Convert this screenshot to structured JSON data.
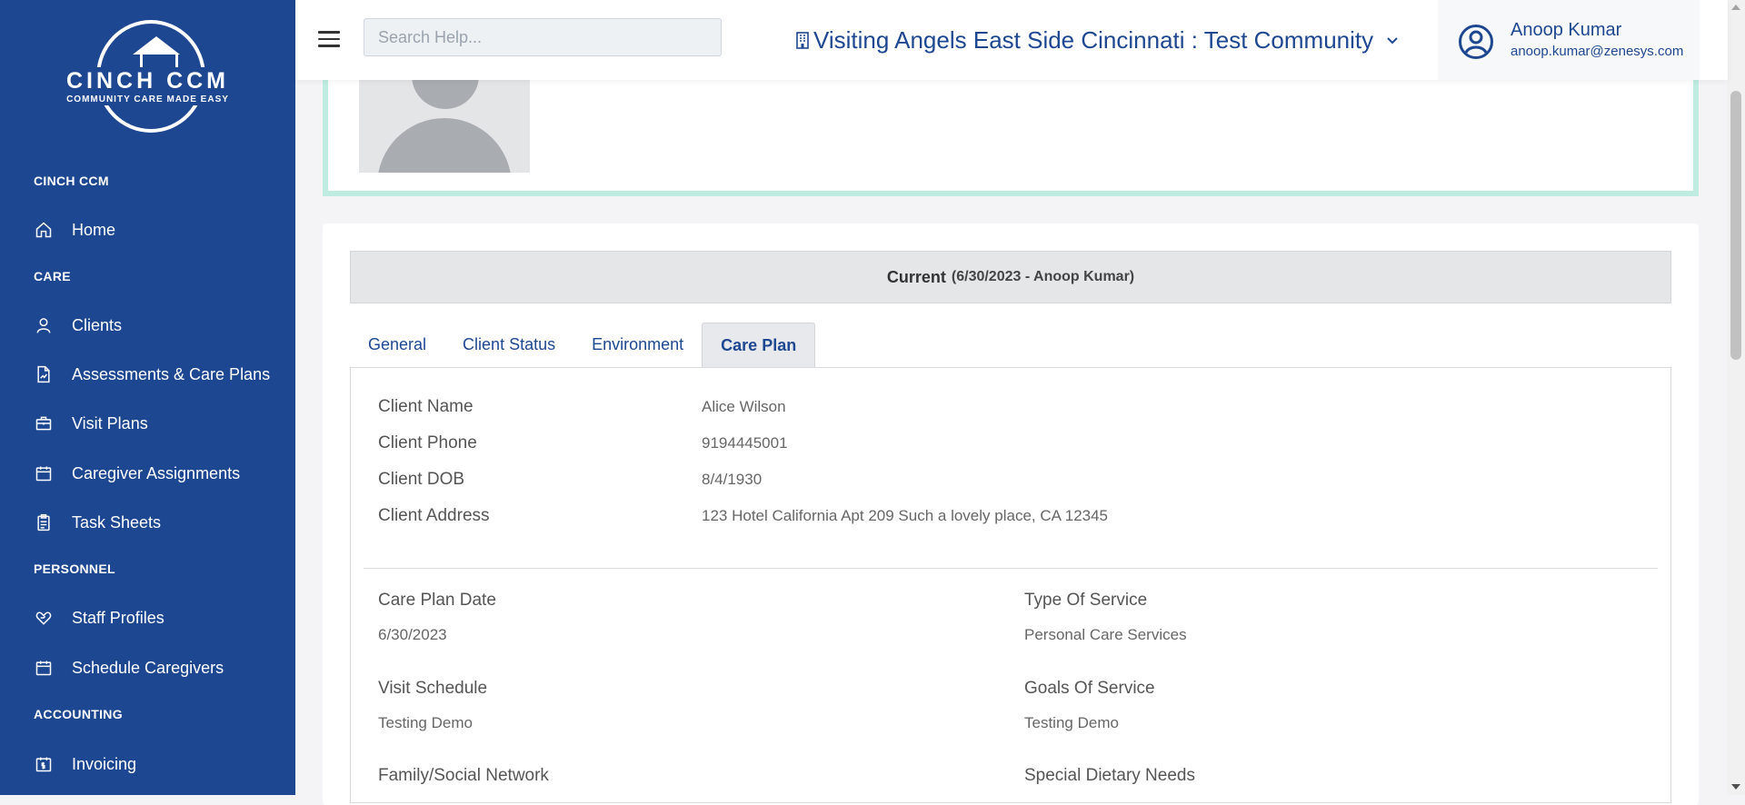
{
  "sidebar": {
    "logo": {
      "title": "CINCH CCM",
      "tagline": "COMMUNITY CARE MADE EASY"
    },
    "sections": [
      {
        "title": "CINCH CCM",
        "items": [
          {
            "label": "Home",
            "icon": "home-icon"
          }
        ]
      },
      {
        "title": "CARE",
        "items": [
          {
            "label": "Clients",
            "icon": "user-icon"
          },
          {
            "label": "Assessments & Care Plans",
            "icon": "document-chart-icon"
          },
          {
            "label": "Visit Plans",
            "icon": "briefcase-icon"
          },
          {
            "label": "Caregiver Assignments",
            "icon": "calendar-icon"
          },
          {
            "label": "Task Sheets",
            "icon": "clipboard-icon"
          }
        ]
      },
      {
        "title": "PERSONNEL",
        "items": [
          {
            "label": "Staff Profiles",
            "icon": "heart-hand-icon"
          },
          {
            "label": "Schedule Caregivers",
            "icon": "calendar-icon"
          }
        ]
      },
      {
        "title": "ACCOUNTING",
        "items": [
          {
            "label": "Invoicing",
            "icon": "invoice-icon"
          }
        ]
      }
    ]
  },
  "header": {
    "search_placeholder": "Search Help...",
    "community": "Visiting Angels East Side Cincinnati : Test Community",
    "user": {
      "name": "Anoop Kumar",
      "email": "anoop.kumar@zenesys.com"
    }
  },
  "current": {
    "label": "Current",
    "detail": "(6/30/2023 - Anoop Kumar)"
  },
  "tabs": [
    {
      "label": "General",
      "active": false
    },
    {
      "label": "Client Status",
      "active": false
    },
    {
      "label": "Environment",
      "active": false
    },
    {
      "label": "Care Plan",
      "active": true
    }
  ],
  "client": {
    "name_label": "Client Name",
    "name": "Alice Wilson",
    "phone_label": "Client Phone",
    "phone": "9194445001",
    "dob_label": "Client DOB",
    "dob": "8/4/1930",
    "address_label": "Client Address",
    "address": "123 Hotel California Apt 209 Such a lovely place, CA 12345"
  },
  "care_plan": {
    "date_label": "Care Plan Date",
    "date": "6/30/2023",
    "service_label": "Type Of Service",
    "service": "Personal Care Services",
    "schedule_label": "Visit Schedule",
    "schedule": "Testing Demo",
    "goals_label": "Goals Of Service",
    "goals": "Testing Demo",
    "family_label": "Family/Social Network",
    "diet_label": "Special Dietary Needs"
  },
  "colors": {
    "sidebar": "#1e4791",
    "accent": "#1e4791",
    "profile_border": "#bfece0"
  }
}
